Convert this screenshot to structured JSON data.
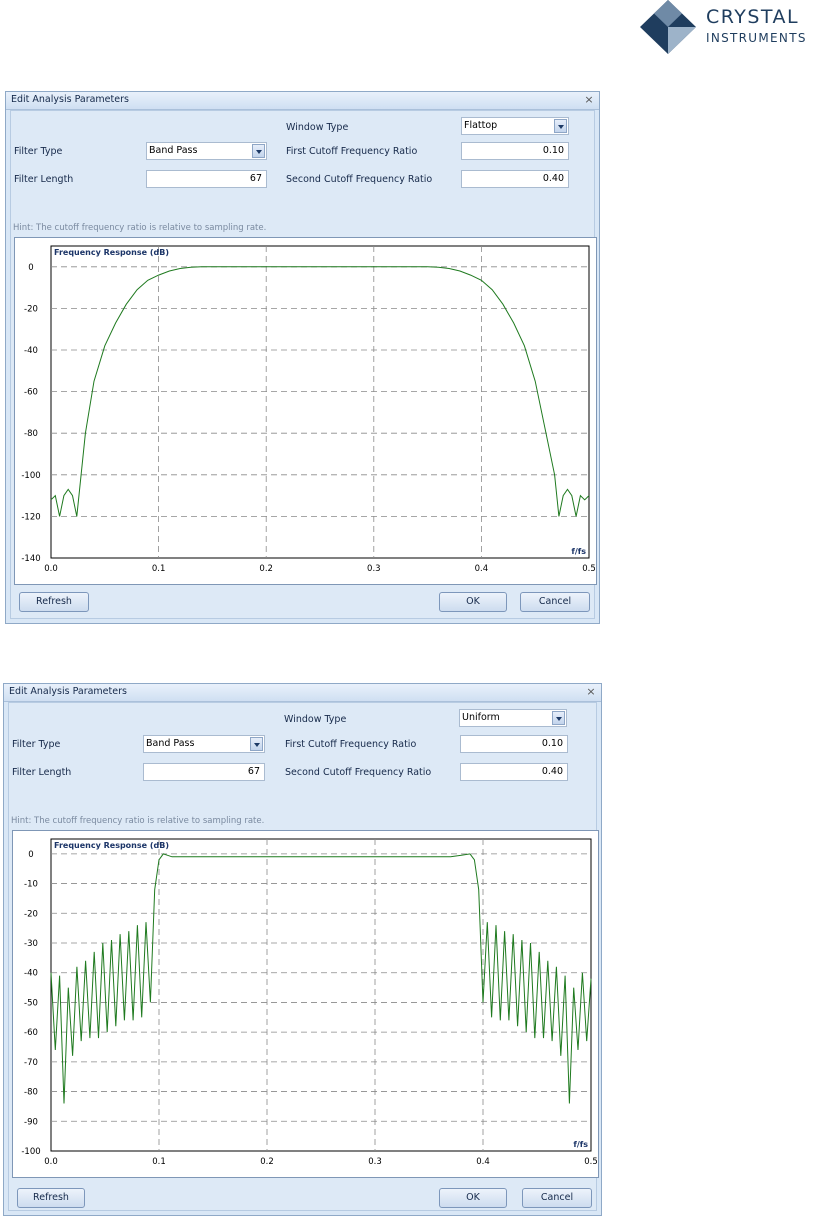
{
  "logo": {
    "line1": "CRYSTAL",
    "line2": "INSTRUMENTS"
  },
  "dialogs": [
    {
      "title": "Edit Analysis Parameters",
      "close_glyph": "×",
      "window_type_label": "Window Type",
      "window_type_value": "Flattop",
      "filter_type_label": "Filter Type",
      "filter_type_value": "Band Pass",
      "filter_length_label": "Filter Length",
      "filter_length_value": "67",
      "first_cutoff_label": "First Cutoff Frequency Ratio",
      "first_cutoff_value": "0.10",
      "second_cutoff_label": "Second Cutoff Frequency Ratio",
      "second_cutoff_value": "0.40",
      "hint": "Hint: The cutoff frequency ratio is relative to sampling rate.",
      "refresh_label": "Refresh",
      "ok_label": "OK",
      "cancel_label": "Cancel"
    },
    {
      "title": "Edit Analysis Parameters",
      "close_glyph": "×",
      "window_type_label": "Window Type",
      "window_type_value": "Uniform",
      "filter_type_label": "Filter Type",
      "filter_type_value": "Band Pass",
      "filter_length_label": "Filter Length",
      "filter_length_value": "67",
      "first_cutoff_label": "First Cutoff Frequency Ratio",
      "first_cutoff_value": "0.10",
      "second_cutoff_label": "Second Cutoff Frequency Ratio",
      "second_cutoff_value": "0.40",
      "hint": "Hint: The cutoff frequency ratio is relative to sampling rate.",
      "refresh_label": "Refresh",
      "ok_label": "OK",
      "cancel_label": "Cancel"
    }
  ],
  "colors": {
    "curve": "#1f7a1f",
    "grid": "#8a8a8a",
    "dialog_bg": "#d9e7f6",
    "logo_dark": "#1f3d5e",
    "logo_light": "#9db3c9"
  },
  "chart_data": [
    {
      "type": "line",
      "title": "Frequency Response (dB)",
      "xlabel": "f/fs",
      "ylabel": "",
      "xlim": [
        0,
        0.5
      ],
      "ylim": [
        -140,
        10
      ],
      "xticks": [
        0.0,
        0.1,
        0.2,
        0.3,
        0.4,
        0.5
      ],
      "xtick_labels": [
        "0.0",
        "0.1",
        "0.2",
        "0.3",
        "0.4",
        "0.5"
      ],
      "yticks": [
        0,
        -20,
        -40,
        -60,
        -80,
        -100,
        -120,
        -140
      ],
      "ytick_labels": [
        "0",
        "-20",
        "-40",
        "-60",
        "-80",
        "-100",
        "-120",
        "-140"
      ],
      "grid": true,
      "series": [
        {
          "x": [
            0,
            0.004,
            0.008,
            0.012,
            0.016,
            0.02,
            0.024,
            0.028,
            0.032,
            0.04,
            0.05,
            0.06,
            0.07,
            0.08,
            0.09,
            0.1,
            0.11,
            0.12,
            0.13,
            0.14,
            0.15,
            0.2,
            0.25,
            0.3,
            0.35,
            0.36,
            0.37,
            0.38,
            0.39,
            0.4,
            0.41,
            0.42,
            0.43,
            0.44,
            0.45,
            0.46,
            0.468,
            0.472,
            0.476,
            0.48,
            0.484,
            0.488,
            0.492,
            0.496,
            0.5
          ],
          "y": [
            -112,
            -110,
            -120,
            -110,
            -107,
            -110,
            -120,
            -100,
            -80,
            -55,
            -38,
            -27,
            -18,
            -11,
            -6.5,
            -4,
            -2,
            -0.8,
            -0.2,
            0,
            0,
            0,
            0,
            0,
            0,
            -0.2,
            -0.8,
            -2,
            -4,
            -6.5,
            -11,
            -18,
            -27,
            -38,
            -55,
            -80,
            -100,
            -120,
            -110,
            -107,
            -110,
            -120,
            -110,
            -112,
            -110
          ]
        }
      ]
    },
    {
      "type": "line",
      "title": "Frequency Response (dB)",
      "xlabel": "f/fs",
      "ylabel": "",
      "xlim": [
        0,
        0.5
      ],
      "ylim": [
        -100,
        5
      ],
      "xticks": [
        0.0,
        0.1,
        0.2,
        0.3,
        0.4,
        0.5
      ],
      "xtick_labels": [
        "0.0",
        "0.1",
        "0.2",
        "0.3",
        "0.4",
        "0.5"
      ],
      "yticks": [
        0,
        -10,
        -20,
        -30,
        -40,
        -50,
        -60,
        -70,
        -80,
        -90,
        -100
      ],
      "ytick_labels": [
        "0",
        "-10",
        "-20",
        "-30",
        "-40",
        "-50",
        "-60",
        "-70",
        "-80",
        "-90",
        "-100"
      ],
      "grid": true,
      "series": [
        {
          "x": [
            0,
            0.004,
            0.008,
            0.012,
            0.016,
            0.02,
            0.024,
            0.028,
            0.032,
            0.036,
            0.04,
            0.044,
            0.048,
            0.052,
            0.056,
            0.06,
            0.064,
            0.068,
            0.072,
            0.076,
            0.08,
            0.084,
            0.088,
            0.092,
            0.096,
            0.1,
            0.104,
            0.108,
            0.112,
            0.12,
            0.13,
            0.15,
            0.2,
            0.25,
            0.3,
            0.35,
            0.37,
            0.38,
            0.388,
            0.392,
            0.396,
            0.4,
            0.404,
            0.408,
            0.412,
            0.416,
            0.42,
            0.424,
            0.428,
            0.432,
            0.436,
            0.44,
            0.444,
            0.448,
            0.452,
            0.456,
            0.46,
            0.464,
            0.468,
            0.472,
            0.476,
            0.48,
            0.484,
            0.488,
            0.492,
            0.496,
            0.5
          ],
          "y": [
            -40,
            -66,
            -41,
            -84,
            -45,
            -68,
            -38,
            -63,
            -36,
            -62,
            -33,
            -62,
            -30,
            -60,
            -29,
            -58,
            -27,
            -56,
            -26,
            -56,
            -24,
            -55,
            -23,
            -50,
            -12,
            -2,
            0,
            -0.5,
            -1,
            -1,
            -1,
            -1,
            -1,
            -1,
            -1,
            -1,
            -1,
            -0.5,
            0,
            -2,
            -12,
            -50,
            -23,
            -55,
            -24,
            -56,
            -26,
            -56,
            -27,
            -58,
            -29,
            -60,
            -30,
            -62,
            -33,
            -62,
            -36,
            -63,
            -38,
            -68,
            -41,
            -84,
            -45,
            -66,
            -40,
            -63,
            -42
          ]
        }
      ]
    }
  ]
}
